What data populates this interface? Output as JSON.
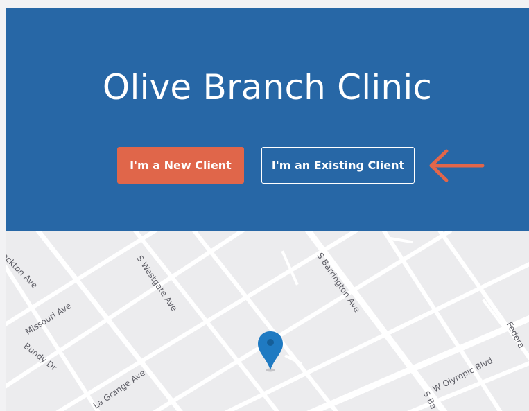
{
  "hero": {
    "title": "Olive Branch Clinic",
    "new_client_label": "I'm a New Client",
    "existing_client_label": "I'm an Existing Client"
  },
  "map": {
    "streets": [
      "S Barrington Ave",
      "Missouri Ave",
      "S Westgate Ave",
      "ockton Ave",
      "Bundy Dr",
      "La Grange Ave",
      "W Olympic Blvd",
      "Federa",
      "S Ba"
    ]
  },
  "colors": {
    "header_blue": "#2767a6",
    "new_client_orange": "#e0664a",
    "arrow_orange": "#e2664a",
    "pin_blue": "#1f7ac2"
  },
  "icons": {
    "pointer": "arrow-left-icon",
    "marker": "map-pin-icon"
  }
}
